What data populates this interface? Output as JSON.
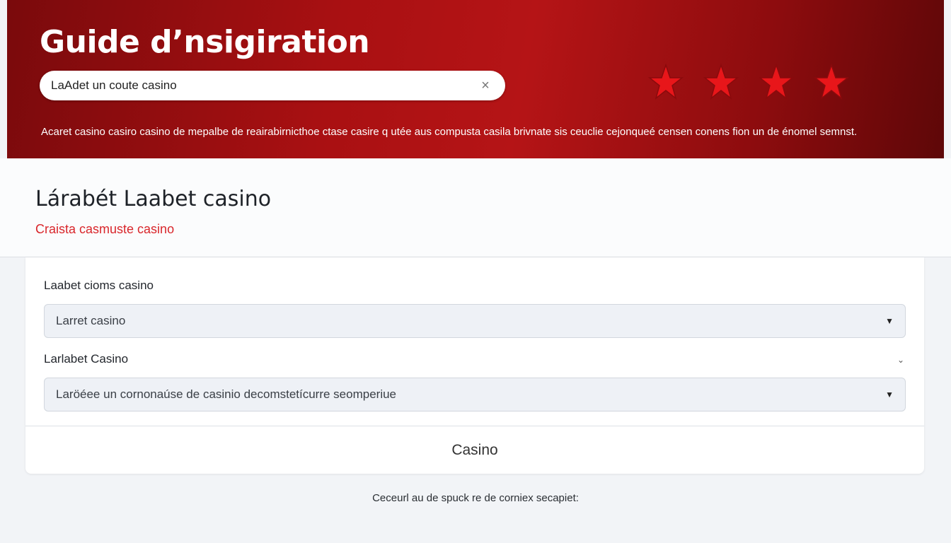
{
  "hero": {
    "title": "Guide d’nsigiration",
    "search_value": "LaAdet un coute casino",
    "clear_icon": "×",
    "rating_stars": 4,
    "description": "Acaret casino casiro casino de mepalbe de reairabirnicthoe ctase casire q utée aus compusta casila brivnate sis ceuclie cejonqueé censen conens fion un de énomel semnst."
  },
  "page": {
    "title": "Lárabét Laabet casino",
    "subtitle": "Craista casmuste casino"
  },
  "form": {
    "field1_label": "Laabet cioms casino",
    "field1_value": "Larret casino",
    "field2_label": "Larlabet Casino",
    "field2_value": "Laröéee un cornonaúse de casinio decomstetícurre seomperiue",
    "button_label": "Casino"
  },
  "footer": {
    "note": "Ceceurl au de spuck re de corniex secapiet:"
  },
  "colors": {
    "hero_red": "#a91012",
    "star_red": "#e8161a",
    "accent_red": "#d9262b"
  }
}
